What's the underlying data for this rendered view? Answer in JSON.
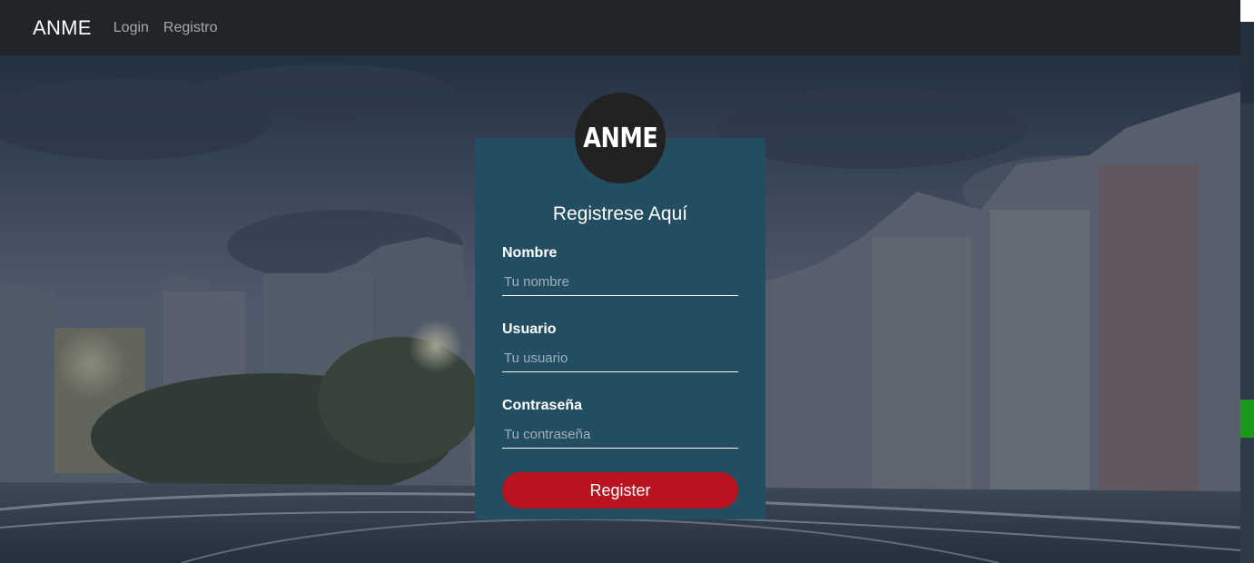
{
  "navbar": {
    "brand": "ANME",
    "links": [
      {
        "label": "Login"
      },
      {
        "label": "Registro"
      }
    ]
  },
  "form": {
    "logo_text": "ANME",
    "title": "Registrese Aquí",
    "fields": [
      {
        "label": "Nombre",
        "placeholder": "Tu nombre"
      },
      {
        "label": "Usuario",
        "placeholder": "Tu usuario"
      },
      {
        "label": "Contraseña",
        "placeholder": "Tu contraseña"
      }
    ],
    "submit_label": "Register"
  },
  "colors": {
    "navbar": "#212529",
    "card": "#234e62",
    "button": "#b8131f",
    "logo_circle": "#222222"
  }
}
